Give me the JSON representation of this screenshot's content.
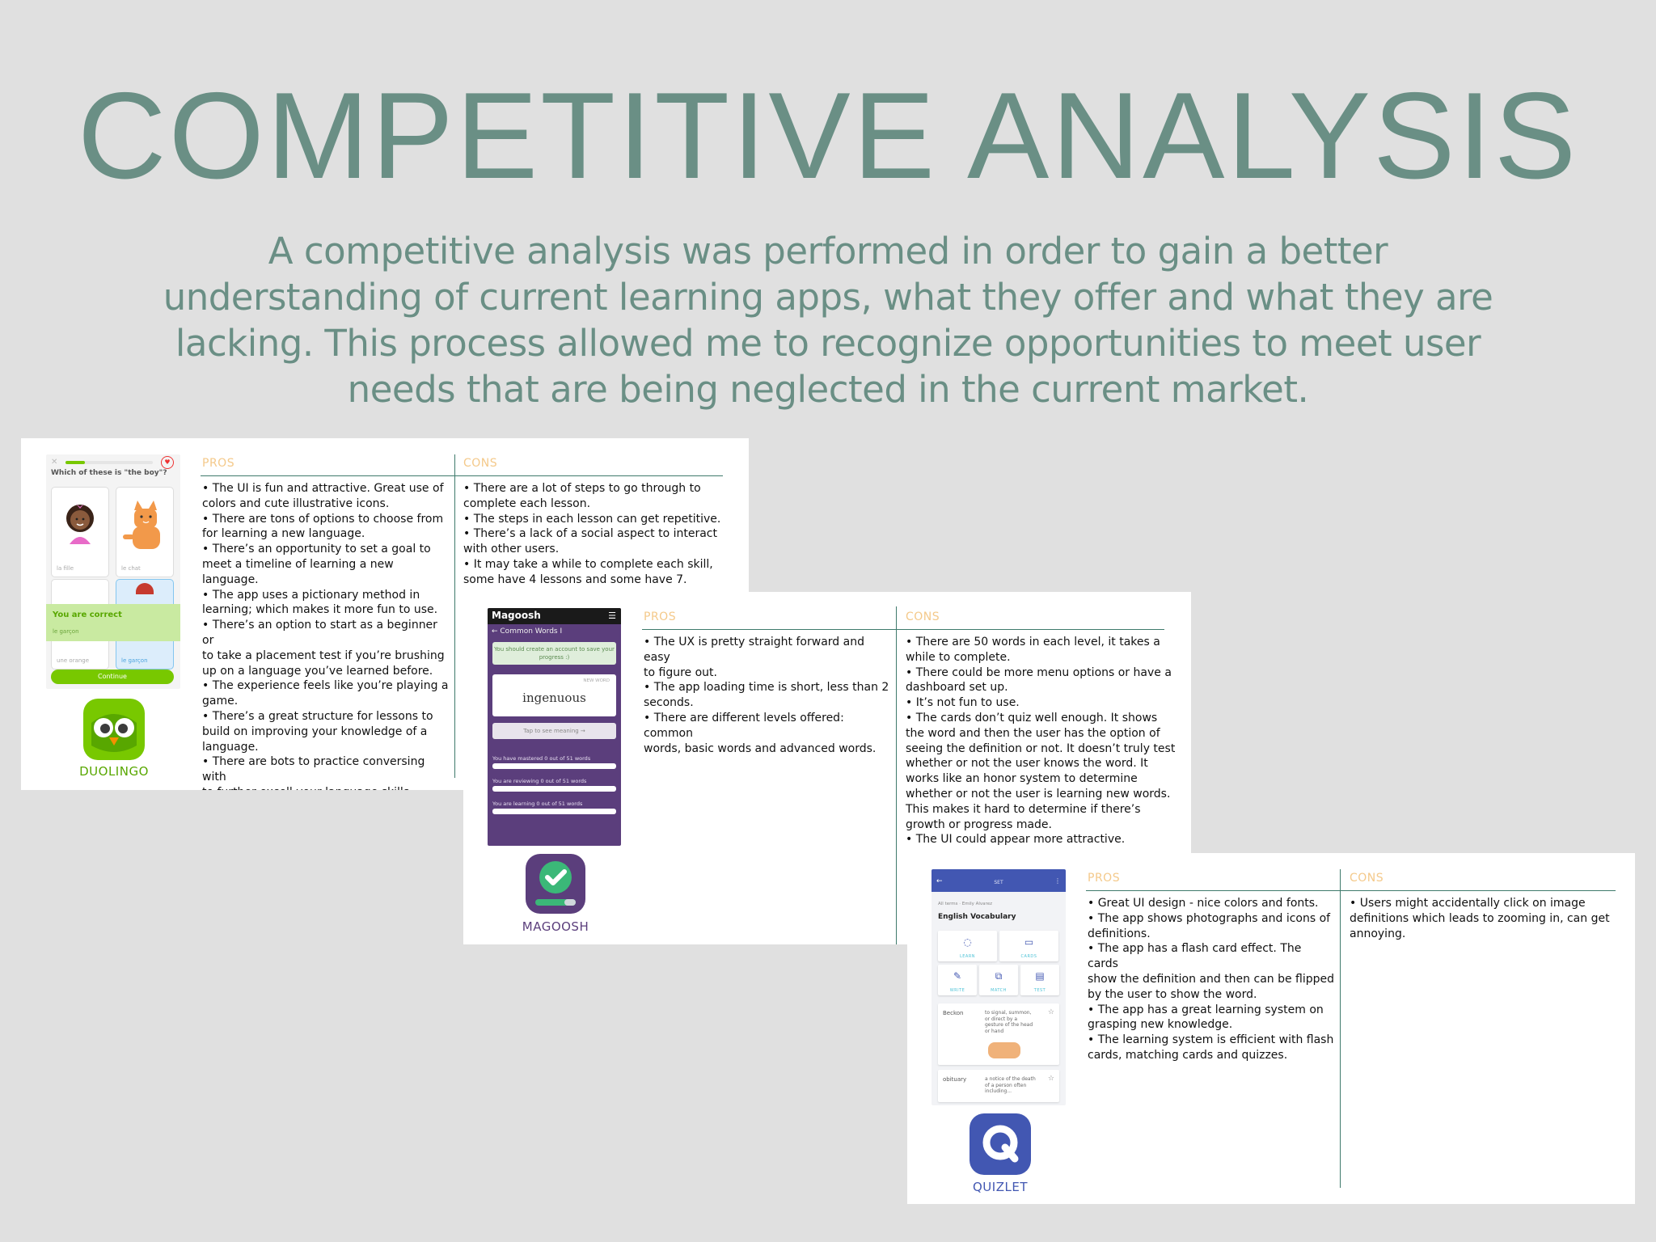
{
  "title": "COMPETITIVE ANALYSIS",
  "intro": "A competitive analysis was performed in order to gain a better understanding of current learning apps, what they offer and what they are lacking. This process allowed me to recognize opportunities to meet user needs that are being neglected in the current market.",
  "column_labels": {
    "pros": "PROS",
    "cons": "CONS"
  },
  "colors": {
    "title": "#6a8f85",
    "rule": "#3f7a6c",
    "column_head": "#f4c98a",
    "duolingo": "#58a700",
    "magoosh": "#5b3e7c",
    "quizlet": "#4257b2"
  },
  "apps": [
    {
      "name": "DUOLINGO",
      "logo_icon": "owl-icon",
      "pros": "• The UI is fun and attractive. Great use of\ncolors and cute illustrative icons.\n• There are tons of options to choose from\nfor learning a new language.\n• There’s an opportunity to set a goal to\nmeet a timeline of learning a new language.\n• The app uses a pictionary method in\nlearning; which makes it more fun to use.\n• There’s an option to start as a beginner or\nto take a placement test if you’re brushing\nup on a language you’ve learned before.\n• The experience feels like you’re playing a\ngame.\n• There’s a great structure for lessons to\nbuild on improving your knowledge of a\nlanguage.\n• There are bots to practice conversing with\nto further excell your language skills.",
      "cons": "• There are a lot of steps to go through to\ncomplete each lesson.\n• The steps in each lesson can get repetitive.\n• There’s a lack of a social aspect to interact\nwith other users.\n• It may take a while to complete each skill,\nsome have 4 lessons and some have 7.",
      "screen": {
        "question": "Which of these is \"the boy\"?",
        "tile_labels": [
          "la fille",
          "le chat",
          "une orange",
          "le garçon"
        ],
        "banner": "You are correct",
        "banner_sub": "le garçon",
        "button": "Continue"
      }
    },
    {
      "name": "MAGOOSH",
      "logo_icon": "checkmark-icon",
      "pros": "• The UX is pretty straight forward and easy\nto figure out.\n• The app loading time is short, less than 2\nseconds.\n• There are different levels offered: common\nwords, basic words and advanced words.",
      "cons": "• There are 50 words in each level, it takes a\nwhile to complete.\n• There could be more menu options or have a\ndashboard set up.\n• It’s not fun to use.\n• The cards don’t quiz well enough. It shows\nthe word and then the user has the option of\nseeing the definition or not. It doesn’t truly test\nwhether or not the user knows the word. It\nworks like an honor system to determine\nwhether or not the user is learning new words.\nThis makes it hard to determine if there’s\ngrowth or progress made.\n• The UI could appear more attractive.",
      "screen": {
        "logo_text": "Magoosh",
        "deck": "← Common Words I",
        "note": "You should create an account to save your progress :)",
        "badge": "NEW WORD",
        "word": "ingenuous",
        "tap": "Tap to see meaning →",
        "stats": [
          "You have mastered 0 out of 51 words",
          "You are reviewing 0 out of 51 words",
          "You are learning 0 out of 51 words"
        ]
      }
    },
    {
      "name": "QUIZLET",
      "logo_icon": "q-icon",
      "pros": "• Great UI design - nice colors and fonts.\n• The app shows photographs and icons of\ndefinitions.\n• The app has a flash card effect. The cards\nshow the definition and then can be flipped\nby the user to show the word.\n• The app has a great learning system on\ngrasping new knowledge.\n• The learning system is efficient with flash\ncards, matching cards and quizzes.",
      "cons": "• Users might accidentally click on image\ndefinitions which leads to zooming in, can get\nannoying.",
      "screen": {
        "header": "SET",
        "meta": "All terms · Emily Alvarez",
        "set_title": "English Vocabulary",
        "modes": [
          "LEARN",
          "CARDS",
          "WRITE",
          "MATCH",
          "TEST"
        ],
        "terms": [
          {
            "word": "Beckon",
            "def": "to signal, summon, or direct by a gesture of the head or hand"
          },
          {
            "word": "obituary",
            "def": "a notice of the death of a person often including..."
          }
        ]
      }
    }
  ]
}
